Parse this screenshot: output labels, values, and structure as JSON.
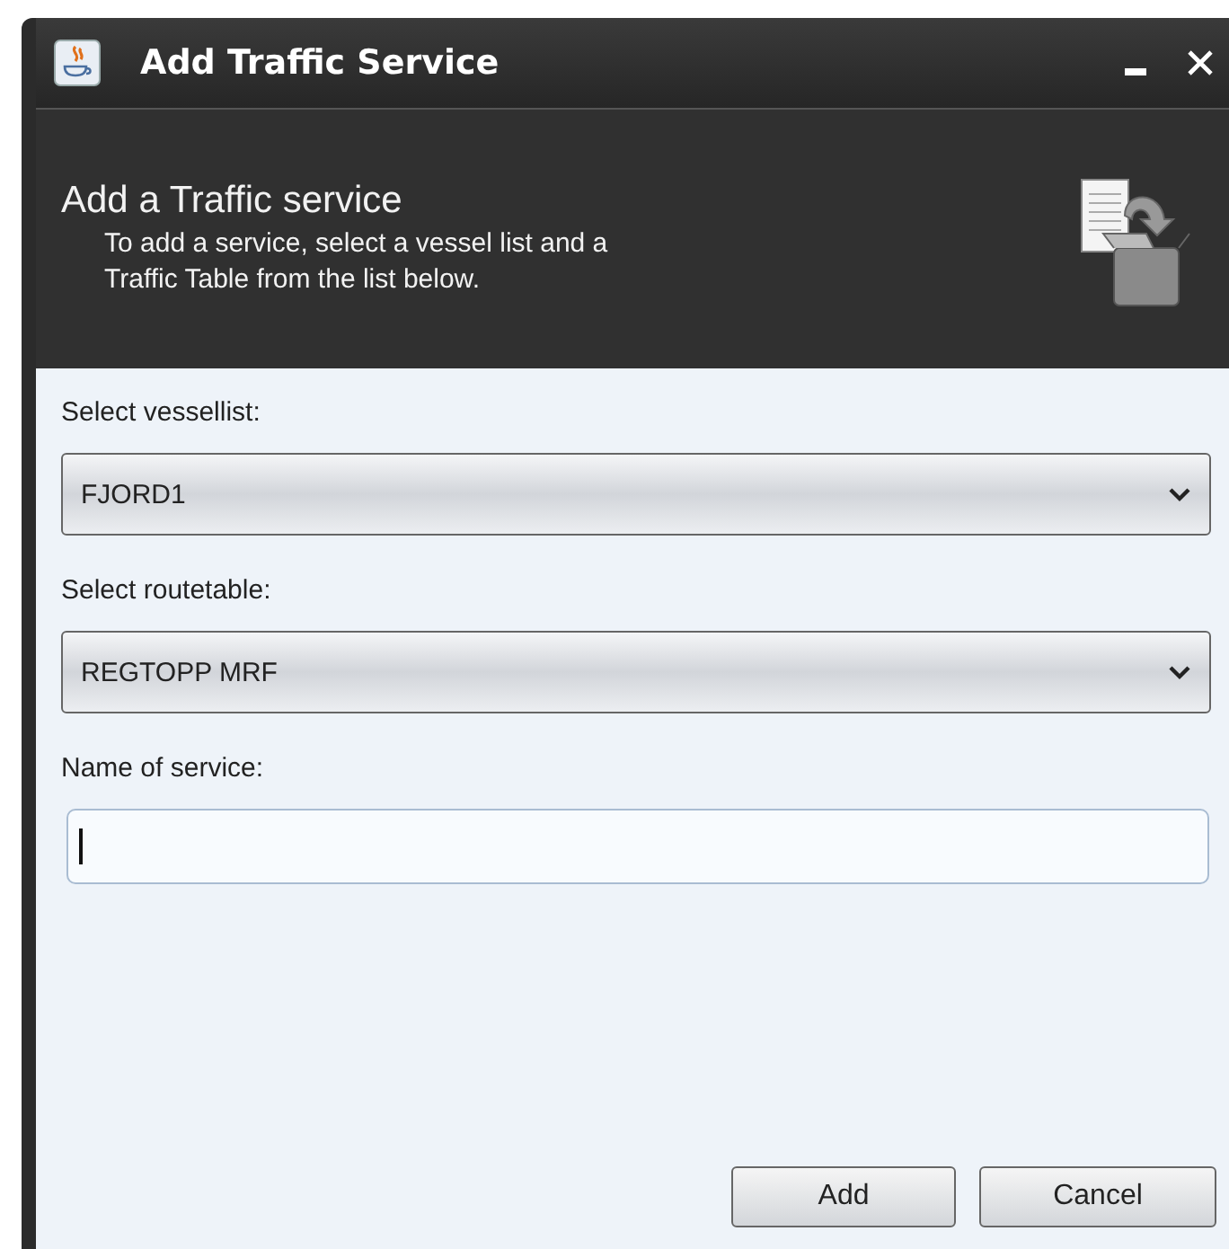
{
  "window": {
    "title": "Add Traffic Service"
  },
  "header": {
    "title": "Add a Traffic service",
    "description": "To add a service, select a vessel list and a Traffic Table from the list below."
  },
  "fields": [
    {
      "kind": "combo",
      "label": "Select vessellist:",
      "value": "FJORD1"
    },
    {
      "kind": "combo",
      "label": "Select routetable:",
      "value": "REGTOPP MRF"
    },
    {
      "kind": "text",
      "label": "Name of service:"
    }
  ],
  "buttons": [
    "Add",
    "Cancel"
  ]
}
